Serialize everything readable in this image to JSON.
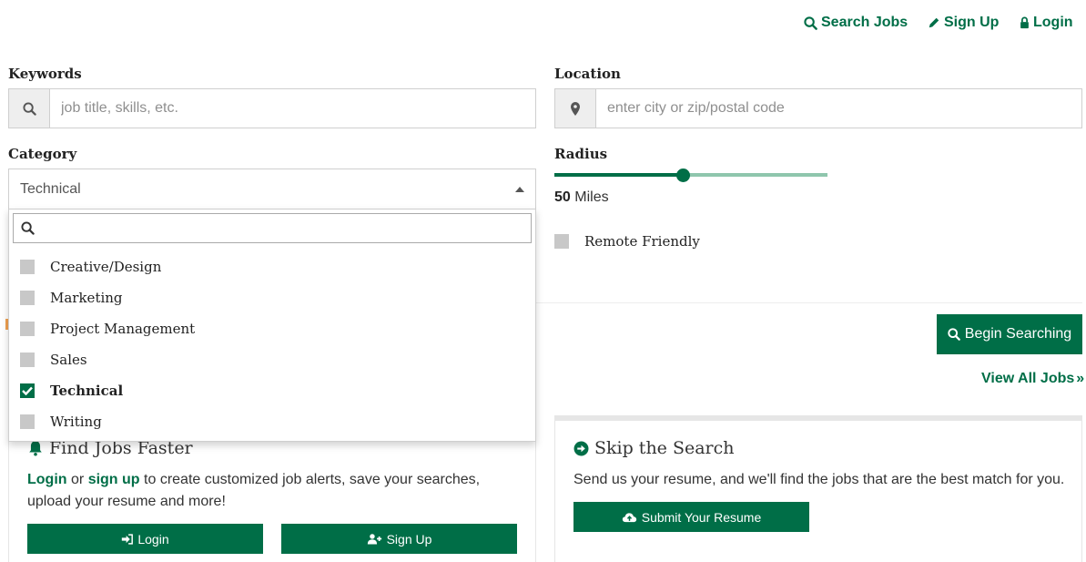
{
  "nav": {
    "search_jobs": "Search Jobs",
    "sign_up": "Sign Up",
    "login": "Login"
  },
  "keywords": {
    "label": "Keywords",
    "placeholder": "job title, skills, etc."
  },
  "location": {
    "label": "Location",
    "placeholder": "enter city or zip/postal code"
  },
  "category": {
    "label": "Category",
    "selected": "Technical",
    "options": [
      {
        "label": "Creative/Design",
        "checked": false
      },
      {
        "label": "Marketing",
        "checked": false
      },
      {
        "label": "Project Management",
        "checked": false
      },
      {
        "label": "Sales",
        "checked": false
      },
      {
        "label": "Technical",
        "checked": true
      },
      {
        "label": "Writing",
        "checked": false
      }
    ]
  },
  "radius": {
    "label": "Radius",
    "value": "50",
    "unit": "Miles",
    "fraction": 0.47
  },
  "remote": {
    "label": "Remote Friendly",
    "checked": false
  },
  "actions": {
    "begin_searching": "Begin Searching",
    "view_all_jobs": "View All Jobs"
  },
  "find_jobs_panel": {
    "title": "Find Jobs Faster",
    "login_link": "Login",
    "or_text": "or",
    "signup_link": "sign up",
    "body_text": "to create customized job alerts, save your searches, upload your resume and more!",
    "login_button": "Login",
    "signup_button": "Sign Up"
  },
  "skip_panel": {
    "title": "Skip the Search",
    "body_text": "Send us your resume, and we'll find the jobs that are the best match for you.",
    "submit_button": "Submit Your Resume"
  },
  "colors": {
    "brand_green": "#006e47",
    "slider_track": "#8fc6ad",
    "checkbox_off": "#c8c8c8"
  }
}
